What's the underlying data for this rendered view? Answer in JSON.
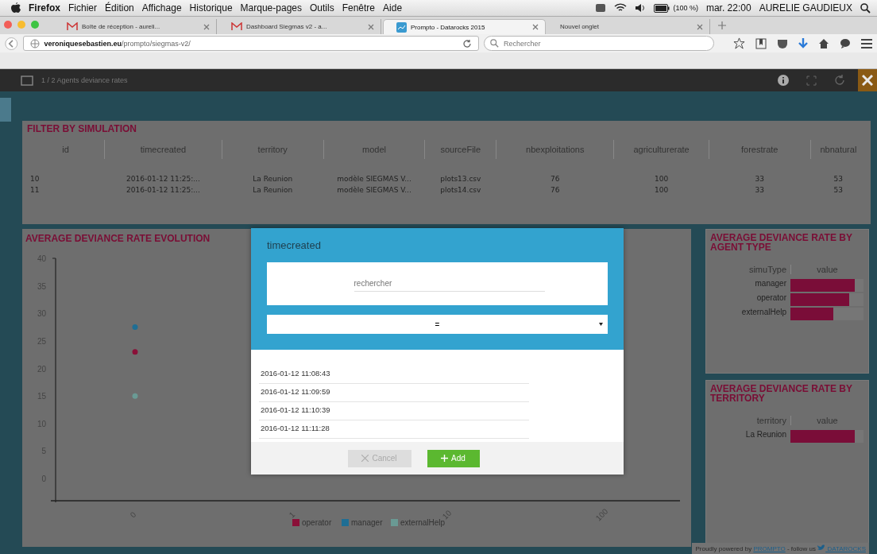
{
  "menu_bar": {
    "app": "Firefox",
    "items": [
      "Fichier",
      "Édition",
      "Affichage",
      "Historique",
      "Marque-pages",
      "Outils",
      "Fenêtre",
      "Aide"
    ],
    "battery": "(100 %)",
    "clock": "mar. 22:00",
    "user": "AURELIE GAUDIEUX"
  },
  "tabs": [
    {
      "label": "Boîte de réception - aureli...",
      "kind": "mail",
      "selected": false
    },
    {
      "label": "Dashboard Siegmas v2 - a...",
      "kind": "mail",
      "selected": false
    },
    {
      "label": "Prompto - Datarocks 2015",
      "kind": "site",
      "selected": true
    },
    {
      "label": "Nouvel onglet",
      "kind": "blank",
      "selected": false
    }
  ],
  "address_bar": {
    "url": "**veroniquesebastien.eu**/prompto/siegmas-v2/",
    "search_placeholder": "Rechercher"
  },
  "app_header": {
    "title": "1 / 2 Agents deviance rates"
  },
  "filter_panel": {
    "title": "FILTER BY SIMULATION",
    "columns": [
      "id",
      "timecreated",
      "territory",
      "model",
      "sourceFile",
      "nbexploitations",
      "agriculturerate",
      "forestrate",
      "nbnatural"
    ],
    "rows": [
      [
        "10",
        "2016-01-12 11:25:...",
        "La Reunion",
        "modèle SIEGMAS V...",
        "plots13.csv",
        "76",
        "100",
        "33",
        "53"
      ],
      [
        "11",
        "2016-01-12 11:25:...",
        "La Reunion",
        "modèle SIEGMAS V...",
        "plots14.csv",
        "76",
        "100",
        "33",
        "53"
      ]
    ]
  },
  "evolution_panel": {
    "title": "AVERAGE DEVIANCE RATE EVOLUTION",
    "chart_data": {
      "type": "line",
      "categories": [
        "0",
        "1",
        "10",
        "100"
      ],
      "yticks": [
        0,
        5,
        10,
        15,
        20,
        25,
        30,
        35,
        40
      ],
      "ylim": [
        -4,
        40
      ],
      "legend": "bottom",
      "series": [
        {
          "name": "operator",
          "color": "#8a1038",
          "marker": "circle",
          "values": [
            23,
            null,
            null,
            null
          ]
        },
        {
          "name": "manager",
          "color": "#1f6e94",
          "marker": "circle",
          "values": [
            27.5,
            null,
            null,
            null
          ]
        },
        {
          "name": "externalHelp",
          "color": "#6a9a94",
          "marker": "circle",
          "values": [
            15,
            null,
            null,
            null
          ]
        }
      ]
    }
  },
  "agent_type_panel": {
    "title": "AVERAGE DEVIANCE RATE BY AGENT TYPE",
    "columns": [
      "simuType",
      "value"
    ],
    "rows": [
      {
        "label": "manager",
        "level": 0.88
      },
      {
        "label": "operator",
        "level": 0.8
      },
      {
        "label": "externalHelp",
        "level": 0.59
      }
    ]
  },
  "territory_panel": {
    "title": "AVERAGE DEVIANCE RATE BY TERRITORY",
    "columns": [
      "territory",
      "value"
    ],
    "rows": [
      {
        "label": "La Reunion",
        "level": 0.88
      }
    ]
  },
  "modal": {
    "title": "timecreated",
    "search_placeholder": "rechercher",
    "operator": "=",
    "options": [
      "2016-01-12 11:08:43",
      "2016-01-12 11:09:59",
      "2016-01-12 11:10:39",
      "2016-01-12 11:11:28"
    ],
    "buttons": [
      {
        "label": "Cancel",
        "kind": "cancel",
        "disabled": true
      },
      {
        "label": "Add",
        "kind": "add",
        "disabled": false
      }
    ]
  },
  "footer": {
    "prefix": "Proudly powered by",
    "link": "PROMPTO",
    "middle": "- follow us",
    "social": "DATAROCKS"
  }
}
